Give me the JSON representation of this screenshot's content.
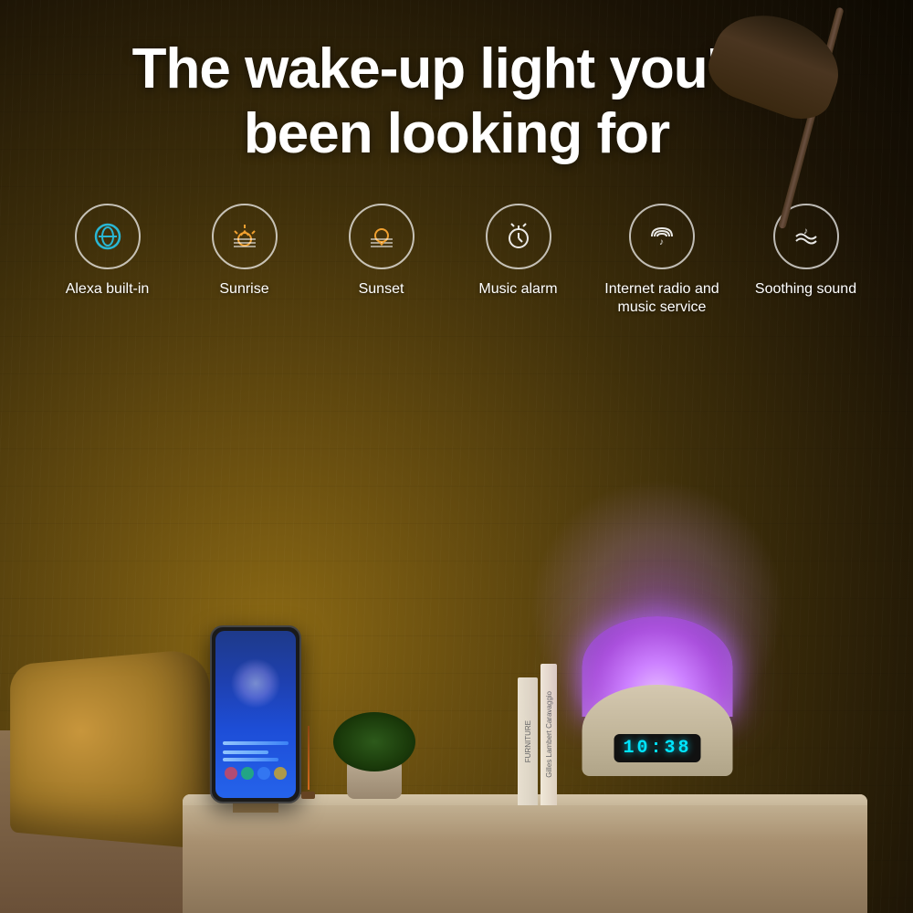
{
  "title": {
    "line1": "The wake-up light you've",
    "line2": "been looking for"
  },
  "features": [
    {
      "id": "alexa",
      "label": "Alexa built-in",
      "icon": "alexa-icon"
    },
    {
      "id": "sunrise",
      "label": "Sunrise",
      "icon": "sunrise-icon"
    },
    {
      "id": "sunset",
      "label": "Sunset",
      "icon": "sunset-icon"
    },
    {
      "id": "music-alarm",
      "label": "Music alarm",
      "icon": "music-alarm-icon"
    },
    {
      "id": "internet-radio",
      "label": "Internet radio and music service",
      "icon": "internet-radio-icon"
    },
    {
      "id": "soothing-sound",
      "label": "Soothing sound",
      "icon": "soothing-sound-icon"
    }
  ],
  "clock_display": "10:38",
  "books": [
    {
      "title": "FURNITURE"
    },
    {
      "title": "Gilles Lambert Caravaggio"
    }
  ]
}
